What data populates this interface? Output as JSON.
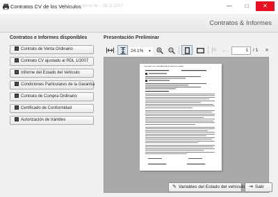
{
  "window": {
    "title": "Contratos CV de los Vehículos",
    "ghost_text": "fecha de ...",
    "ghost_date": "06.11.2017",
    "buttons": {
      "minimize": "—",
      "maximize": "□",
      "close": "✕"
    }
  },
  "header": {
    "title": "Contratos & Informes"
  },
  "left_panel": {
    "label": "Contratos e Informes disponibles",
    "items": [
      {
        "label": "Contrato de Venta Ordinario"
      },
      {
        "label": "Contrato CV ajustado al RDL 1/2007"
      },
      {
        "label": "Informe del Estado del Vehículo"
      },
      {
        "label": "Condiciones Particulares de la Garantía"
      },
      {
        "label": "Contrato de Compra Ordinario"
      },
      {
        "label": "Certificado de Conformidad"
      },
      {
        "label": "Autorización de trámites"
      }
    ]
  },
  "preview": {
    "label": "Presentación Preliminar",
    "zoom": "24.1%",
    "page_current": "1",
    "page_total_label": "/ 1",
    "document_heading": "CONTRATO DE COMPRAVENTA DE VEHÍCULO USADO"
  },
  "footer": {
    "variables_button": "Variables del Estado del vehículo",
    "exit_button": "Salir"
  }
}
